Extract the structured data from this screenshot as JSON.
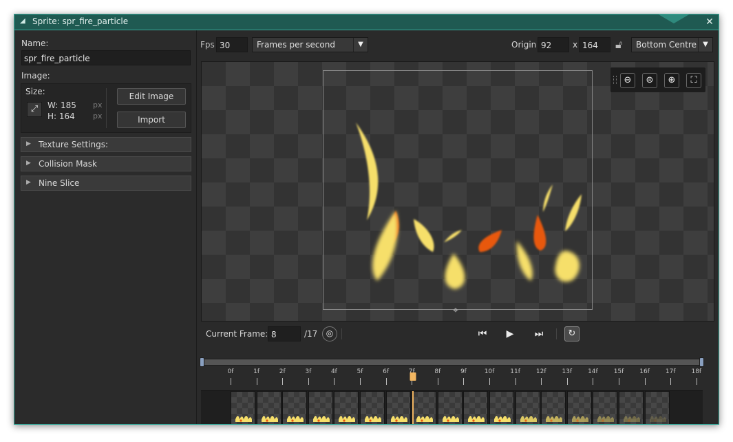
{
  "window": {
    "title": "Sprite: spr_fire_particle",
    "close_glyph": "✕",
    "collapse_glyph": "◢"
  },
  "left": {
    "name_label": "Name:",
    "name_value": "spr_fire_particle",
    "image_label": "Image:",
    "size_label": "Size:",
    "width_label": "W: 185",
    "height_label": "H: 164",
    "unit_px_w": "px",
    "unit_px_h": "px",
    "edit_image_label": "Edit Image",
    "import_label": "Import",
    "sections": [
      {
        "label": "Texture Settings:"
      },
      {
        "label": "Collision Mask"
      },
      {
        "label": "Nine Slice"
      }
    ]
  },
  "toolbar": {
    "fps_label": "Fps",
    "fps_value": "30",
    "fps_mode": "Frames per second",
    "origin_label": "Origin",
    "origin_x": "92",
    "origin_sep": "x",
    "origin_y": "164",
    "origin_preset": "Bottom Centre"
  },
  "playback": {
    "current_frame_label": "Current Frame:",
    "current_frame_value": "8",
    "total_frames": "/17",
    "loop_on": true
  },
  "timeline": {
    "ticks": [
      "0f",
      "1f",
      "2f",
      "3f",
      "4f",
      "5f",
      "6f",
      "7f",
      "8f",
      "9f",
      "10f",
      "11f",
      "12f",
      "13f",
      "14f",
      "15f",
      "16f",
      "17f",
      "18f"
    ],
    "playhead_frame": 7,
    "frame_count": 17
  },
  "icons": {
    "resize": "resize-icon",
    "lock": "lock-open-icon",
    "zoom_out": "zoom-out-icon",
    "zoom_reset": "zoom-reset-icon",
    "zoom_in": "zoom-in-icon",
    "fit": "fit-screen-icon",
    "first": "skip-first-icon",
    "play": "play-icon",
    "last": "skip-last-icon",
    "loop": "loop-icon",
    "onion": "onion-skin-icon"
  },
  "colors": {
    "accent": "#3aa99a",
    "titlebar": "#1f5a52",
    "playhead": "#f2b661",
    "flame_yellow": "#f6df6a",
    "flame_orange": "#e8580c"
  }
}
